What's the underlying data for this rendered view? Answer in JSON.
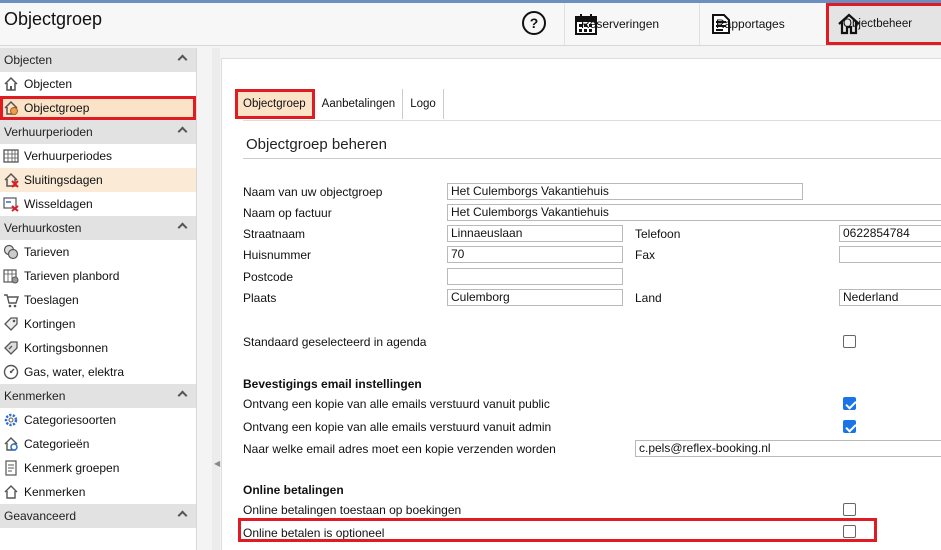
{
  "header": {
    "title": "Objectgroep",
    "help_glyph": "?",
    "nav": [
      {
        "label": "Reserveringen",
        "icon": "calendar-icon"
      },
      {
        "label": "Rapportages",
        "icon": "report-icon"
      },
      {
        "label": "Objectbeheer",
        "icon": "home-icon"
      }
    ]
  },
  "sidebar": {
    "sections": [
      {
        "label": "Objecten",
        "items": [
          {
            "label": "Objecten",
            "icon": "house-icon"
          },
          {
            "label": "Objectgroep",
            "icon": "house-globe-icon"
          }
        ]
      },
      {
        "label": "Verhuurperioden",
        "items": [
          {
            "label": "Verhuurperiodes",
            "icon": "calendar-grid-icon"
          },
          {
            "label": "Sluitingsdagen",
            "icon": "house-closed-icon"
          },
          {
            "label": "Wisseldagen",
            "icon": "swap-icon"
          }
        ]
      },
      {
        "label": "Verhuurkosten",
        "items": [
          {
            "label": "Tarieven",
            "icon": "coins-icon"
          },
          {
            "label": "Tarieven planbord",
            "icon": "calendar-coins-icon"
          },
          {
            "label": "Toeslagen",
            "icon": "cart-icon"
          },
          {
            "label": "Kortingen",
            "icon": "tag-icon"
          },
          {
            "label": "Kortingsbonnen",
            "icon": "coupon-icon"
          },
          {
            "label": "Gas, water, elektra",
            "icon": "meter-icon"
          }
        ]
      },
      {
        "label": "Kenmerken",
        "items": [
          {
            "label": "Categoriesoorten",
            "icon": "gear-icon"
          },
          {
            "label": "Categorieën",
            "icon": "house-gear-icon"
          },
          {
            "label": "Kenmerk groepen",
            "icon": "document-icon"
          },
          {
            "label": "Kenmerken",
            "icon": "house-outline-icon"
          }
        ]
      },
      {
        "label": "Geavanceerd",
        "items": []
      }
    ]
  },
  "tabs": [
    "Objectgroep",
    "Aanbetalingen",
    "Logo"
  ],
  "main": {
    "title": "Objectgroep beheren",
    "fields": {
      "naam_label": "Naam van uw objectgroep",
      "naam_value": "Het Culemborgs Vakantiehuis",
      "factuur_label": "Naam op factuur",
      "factuur_value": "Het Culemborgs Vakantiehuis",
      "straat_label": "Straatnaam",
      "straat_value": "Linnaeuslaan",
      "huisnr_label": "Huisnummer",
      "huisnr_value": "70",
      "postcode_label": "Postcode",
      "postcode_value": "",
      "plaats_label": "Plaats",
      "plaats_value": "Culemborg",
      "telefoon_label": "Telefoon",
      "telefoon_value": "0622854784",
      "fax_label": "Fax",
      "fax_value": "",
      "land_label": "Land",
      "land_value": "Nederland"
    },
    "standaard_label": "Standaard geselecteerd in agenda",
    "standaard_checked": false,
    "email_heading": "Bevestigings email instellingen",
    "email_public_label": "Ontvang een kopie van alle emails verstuurd vanuit public",
    "email_public_checked": true,
    "email_admin_label": "Ontvang een kopie van alle emails verstuurd vanuit admin",
    "email_admin_checked": true,
    "email_addr_label": "Naar welke email adres moet een kopie verzenden worden",
    "email_addr_value": "c.pels@reflex-booking.nl",
    "online_heading": "Online betalingen",
    "online_toestaan_label": "Online betalingen toestaan op boekingen",
    "online_toestaan_checked": false,
    "online_optioneel_label": "Online betalen is optioneel",
    "online_optioneel_checked": false
  },
  "colors": {
    "highlight_border": "#e01b24",
    "active_bg": "#fbe3c8",
    "checkbox_on": "#1a73e8"
  }
}
